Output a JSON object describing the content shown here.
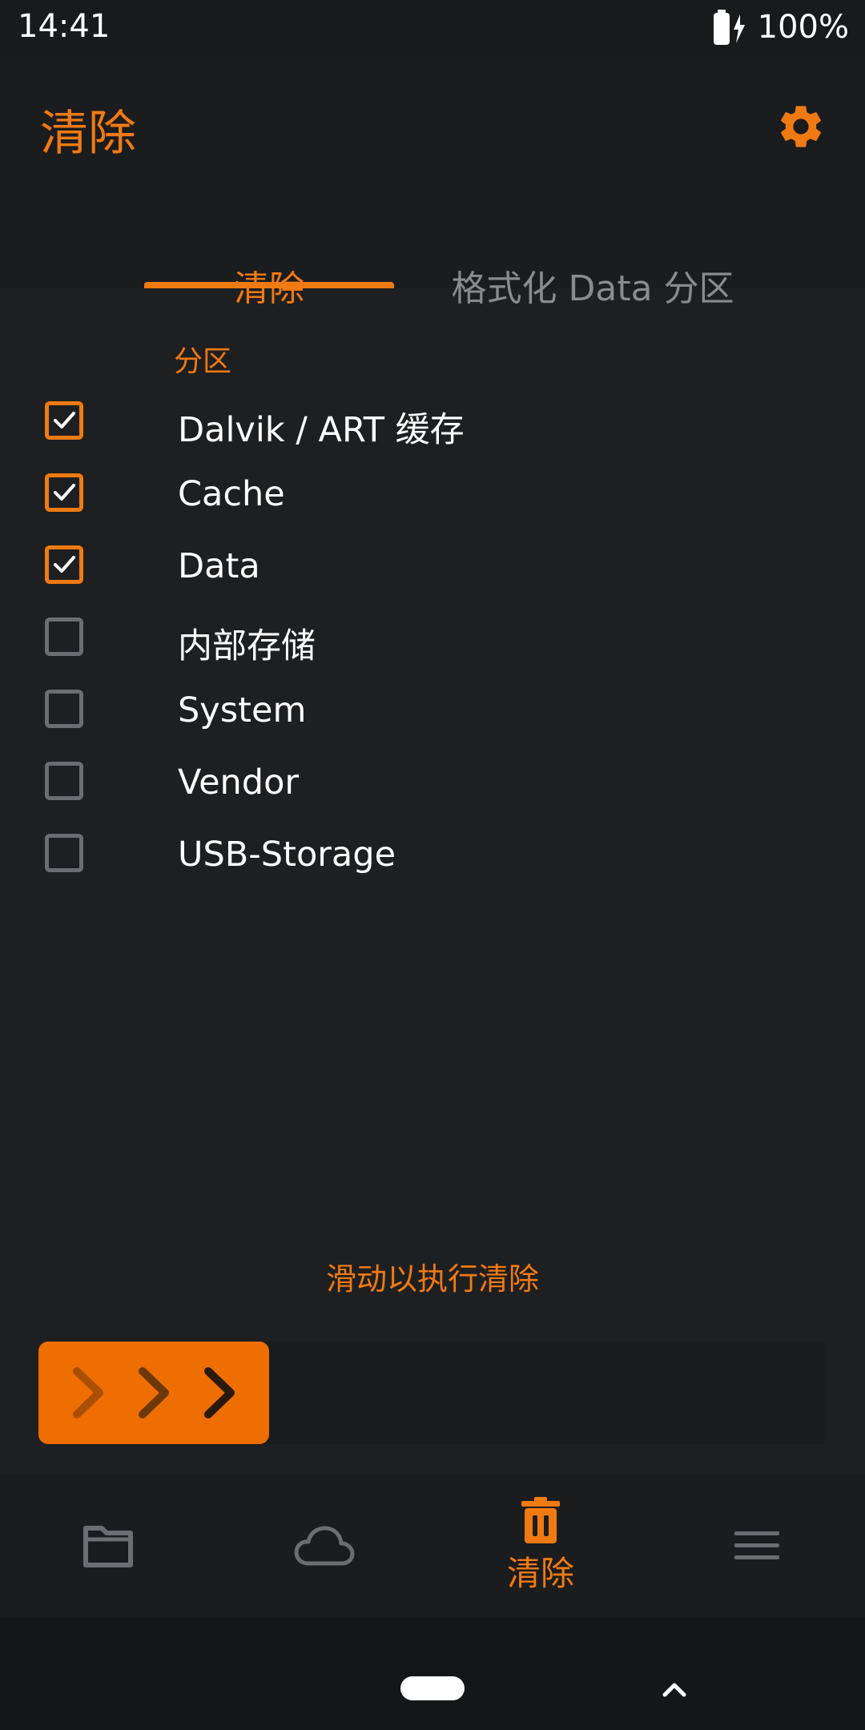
{
  "status_bar": {
    "time": "14:41",
    "battery": "100%",
    "battery_icon": "battery-charging-icon"
  },
  "header": {
    "title": "清除",
    "settings_icon": "gear-icon"
  },
  "tabs": [
    {
      "label": "清除",
      "active": true
    },
    {
      "label": "格式化 Data 分区",
      "active": false
    }
  ],
  "section": {
    "label": "分区"
  },
  "options": [
    {
      "label": "Dalvik / ART 缓存",
      "checked": true
    },
    {
      "label": "Cache",
      "checked": true
    },
    {
      "label": "Data",
      "checked": true
    },
    {
      "label": "内部存储",
      "checked": false
    },
    {
      "label": "System",
      "checked": false
    },
    {
      "label": "Vendor",
      "checked": false
    },
    {
      "label": "USB-Storage",
      "checked": false
    }
  ],
  "swipe": {
    "hint": "滑动以执行清除"
  },
  "bottom_nav": [
    {
      "icon": "folder-icon",
      "label": "",
      "active": false
    },
    {
      "icon": "cloud-icon",
      "label": "",
      "active": false
    },
    {
      "icon": "trash-icon",
      "label": "清除",
      "active": true
    },
    {
      "icon": "menu-icon",
      "label": "",
      "active": false
    }
  ],
  "colors": {
    "accent": "#f07a12",
    "background": "#1e1f21",
    "inactive": "#6c6d70"
  }
}
